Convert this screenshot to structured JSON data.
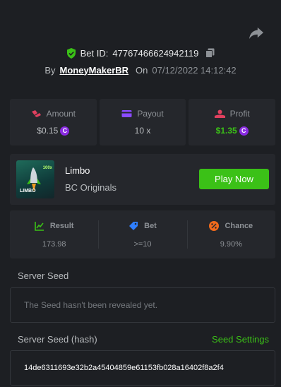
{
  "header": {
    "bet_id_label": "Bet ID:",
    "bet_id": "47767466624942119",
    "by_label": "By",
    "username": "MoneyMakerBR",
    "on_label": "On",
    "date": "07/12/2022 14:12:42"
  },
  "stats": {
    "amount": {
      "label": "Amount",
      "value": "$0.15"
    },
    "payout": {
      "label": "Payout",
      "value": "10 x"
    },
    "profit": {
      "label": "Profit",
      "value": "$1.35"
    },
    "coin_glyph": "C"
  },
  "game": {
    "thumbnail_tag": "LIMBO",
    "thumbnail_multiplier": "100x",
    "title": "Limbo",
    "subtitle": "BC Originals",
    "play_label": "Play Now"
  },
  "result": {
    "result": {
      "label": "Result",
      "value": "173.98"
    },
    "bet": {
      "label": "Bet",
      "value": ">=10"
    },
    "chance": {
      "label": "Chance",
      "value": "9.90%"
    }
  },
  "server_seed": {
    "label": "Server Seed",
    "value": "The Seed hasn't been revealed yet."
  },
  "server_seed_hash": {
    "label": "Server Seed (hash)",
    "settings_label": "Seed Settings",
    "value": "14de6311693e32b2a45404859e61153fb028a16402f8a2f4"
  },
  "colors": {
    "background": "#1d1f23",
    "panel": "#25272c",
    "accent_green": "#3bc117",
    "coin_purple": "#8a2be2"
  }
}
